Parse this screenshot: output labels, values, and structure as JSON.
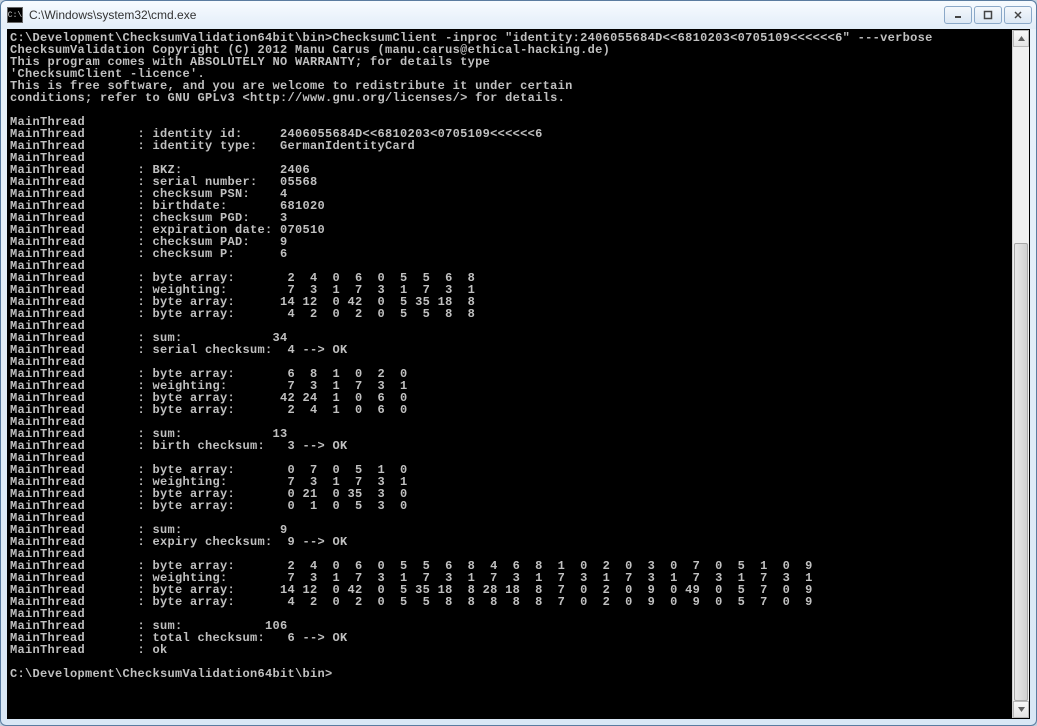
{
  "window": {
    "title": "C:\\Windows\\system32\\cmd.exe",
    "icon_glyph": "C:\\"
  },
  "terminal": {
    "lines": [
      "C:\\Development\\ChecksumValidation64bit\\bin>ChecksumClient -inproc \"identity:2406055684D<<6810203<0705109<<<<<<6\" ---verbose",
      "ChecksumValidation Copyright (C) 2012 Manu Carus (manu.carus@ethical-hacking.de)",
      "This program comes with ABSOLUTELY NO WARRANTY; for details type",
      "'ChecksumClient -licence'.",
      "This is free software, and you are welcome to redistribute it under certain",
      "conditions; refer to GNU GPLv3 <http://www.gnu.org/licenses/> for details.",
      "",
      "MainThread",
      "MainThread       : identity id:     2406055684D<<6810203<0705109<<<<<<6",
      "MainThread       : identity type:   GermanIdentityCard",
      "MainThread",
      "MainThread       : BKZ:             2406",
      "MainThread       : serial number:   05568",
      "MainThread       : checksum PSN:    4",
      "MainThread       : birthdate:       681020",
      "MainThread       : checksum PGD:    3",
      "MainThread       : expiration date: 070510",
      "MainThread       : checksum PAD:    9",
      "MainThread       : checksum P:      6",
      "MainThread",
      "MainThread       : byte array:       2  4  0  6  0  5  5  6  8",
      "MainThread       : weighting:        7  3  1  7  3  1  7  3  1",
      "MainThread       : byte array:      14 12  0 42  0  5 35 18  8",
      "MainThread       : byte array:       4  2  0  2  0  5  5  8  8",
      "MainThread",
      "MainThread       : sum:            34",
      "MainThread       : serial checksum:  4 --> OK",
      "MainThread",
      "MainThread       : byte array:       6  8  1  0  2  0",
      "MainThread       : weighting:        7  3  1  7  3  1",
      "MainThread       : byte array:      42 24  1  0  6  0",
      "MainThread       : byte array:       2  4  1  0  6  0",
      "MainThread",
      "MainThread       : sum:            13",
      "MainThread       : birth checksum:   3 --> OK",
      "MainThread",
      "MainThread       : byte array:       0  7  0  5  1  0",
      "MainThread       : weighting:        7  3  1  7  3  1",
      "MainThread       : byte array:       0 21  0 35  3  0",
      "MainThread       : byte array:       0  1  0  5  3  0",
      "MainThread",
      "MainThread       : sum:             9",
      "MainThread       : expiry checksum:  9 --> OK",
      "MainThread",
      "MainThread       : byte array:       2  4  0  6  0  5  5  6  8  4  6  8  1  0  2  0  3  0  7  0  5  1  0  9",
      "MainThread       : weighting:        7  3  1  7  3  1  7  3  1  7  3  1  7  3  1  7  3  1  7  3  1  7  3  1",
      "MainThread       : byte array:      14 12  0 42  0  5 35 18  8 28 18  8  7  0  2  0  9  0 49  0  5  7  0  9",
      "MainThread       : byte array:       4  2  0  2  0  5  5  8  8  8  8  8  7  0  2  0  9  0  9  0  5  7  0  9",
      "MainThread",
      "MainThread       : sum:           106",
      "MainThread       : total checksum:   6 --> OK",
      "MainThread       : ok",
      "",
      "C:\\Development\\ChecksumValidation64bit\\bin>"
    ]
  }
}
